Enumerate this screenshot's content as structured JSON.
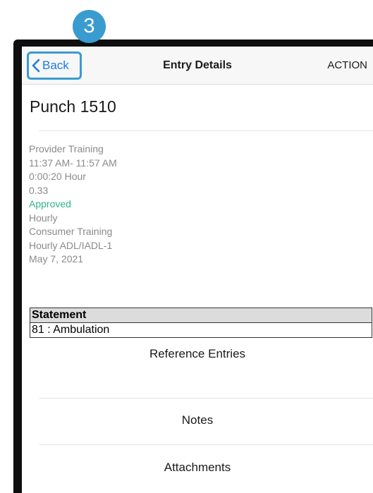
{
  "step_badge": "3",
  "nav": {
    "back_label": "Back",
    "title": "Entry Details",
    "action_label": "ACTION"
  },
  "entry": {
    "title": "Punch 1510",
    "details": [
      "Provider Training",
      "11:37 AM- 11:57 AM",
      "0:00:20 Hour",
      "0.33",
      "Approved",
      "Hourly",
      "Consumer Training",
      "Hourly ADL/IADL-1",
      "May 7, 2021"
    ]
  },
  "statement": {
    "header": "Statement",
    "value": "81 : Ambulation"
  },
  "menu": {
    "reference_entries": "Reference Entries",
    "notes": "Notes",
    "attachments": "Attachments"
  },
  "colors": {
    "badge": "#3a9bcf",
    "link": "#1f7ae0",
    "approved": "#2fb58a"
  }
}
